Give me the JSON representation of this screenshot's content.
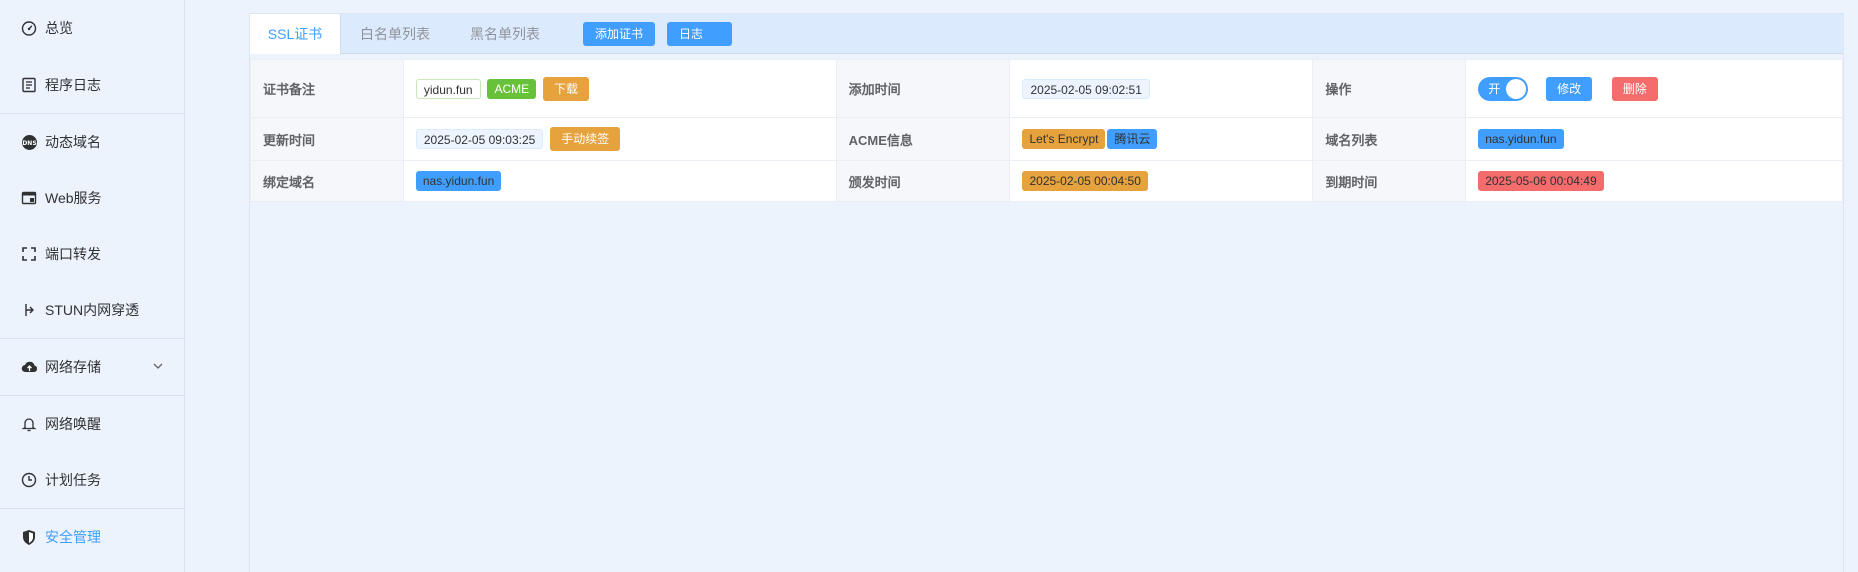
{
  "sidebar": {
    "items": [
      {
        "label": "总览",
        "icon": "dashboard-icon"
      },
      {
        "label": "程序日志",
        "icon": "log-icon"
      },
      {
        "label": "动态域名",
        "icon": "dns-icon"
      },
      {
        "label": "Web服务",
        "icon": "web-icon"
      },
      {
        "label": "端口转发",
        "icon": "port-forward-icon"
      },
      {
        "label": "STUN内网穿透",
        "icon": "stun-icon"
      },
      {
        "label": "网络存储",
        "icon": "cloud-upload-icon"
      },
      {
        "label": "网络唤醒",
        "icon": "bell-icon"
      },
      {
        "label": "计划任务",
        "icon": "clock-icon"
      },
      {
        "label": "安全管理",
        "icon": "shield-icon"
      }
    ],
    "active_index": 9,
    "accent_color": "#409eff"
  },
  "tabs": {
    "ssl": "SSL证书",
    "whitelist": "白名单列表",
    "blacklist": "黑名单列表",
    "add_cert": "添加证书",
    "log": "日志"
  },
  "cert": {
    "labels": {
      "remark": "证书备注",
      "added_time": "添加时间",
      "actions": "操作",
      "updated_time": "更新时间",
      "acme_info": "ACME信息",
      "domain_list": "域名列表",
      "bound_domain": "绑定域名",
      "issued_time": "颁发时间",
      "expire_time": "到期时间"
    },
    "remark": "yidun.fun",
    "acme_tag": "ACME",
    "download": "下载",
    "added_time": "2025-02-05 09:02:51",
    "switch_label": "开",
    "switch_on": true,
    "edit": "修改",
    "delete": "删除",
    "updated_time": "2025-02-05 09:03:25",
    "manual_renew": "手动续签",
    "ca": "Let's Encrypt",
    "dns_provider": "腾讯云",
    "domain_list": "nas.yidun.fun",
    "bound_domain": "nas.yidun.fun",
    "issued_time": "2025-02-05 00:04:50",
    "expire_time": "2025-05-06 00:04:49"
  }
}
